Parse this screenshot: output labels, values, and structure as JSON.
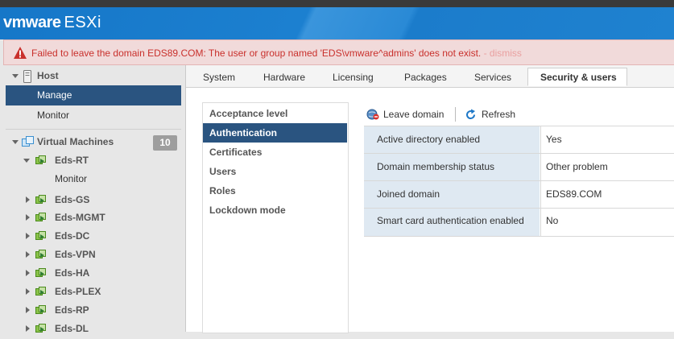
{
  "app": {
    "logo_vm": "vmware",
    "logo_product": "ESXi"
  },
  "alert": {
    "message": "Failed to leave the domain EDS89.COM: The user or group named 'EDS\\vmware^admins' does not exist.",
    "dismiss": " - dismiss"
  },
  "sidebar": {
    "host": {
      "label": "Host",
      "items": [
        "Manage",
        "Monitor"
      ]
    },
    "vms": {
      "label": "Virtual Machines",
      "count": "10",
      "list": [
        {
          "name": "Eds-RT",
          "expanded": true,
          "children": [
            "Monitor"
          ]
        },
        {
          "name": "Eds-GS"
        },
        {
          "name": "Eds-MGMT"
        },
        {
          "name": "Eds-DC"
        },
        {
          "name": "Eds-VPN"
        },
        {
          "name": "Eds-HA"
        },
        {
          "name": "Eds-PLEX"
        },
        {
          "name": "Eds-RP"
        },
        {
          "name": "Eds-DL"
        }
      ]
    }
  },
  "tabs": [
    "System",
    "Hardware",
    "Licensing",
    "Packages",
    "Services",
    "Security & users"
  ],
  "active_tab": "Security & users",
  "subnav": [
    "Acceptance level",
    "Authentication",
    "Certificates",
    "Users",
    "Roles",
    "Lockdown mode"
  ],
  "active_subnav": "Authentication",
  "toolbar": {
    "leave_domain": "Leave domain",
    "refresh": "Refresh"
  },
  "auth_table": [
    {
      "key": "Active directory enabled",
      "value": "Yes"
    },
    {
      "key": "Domain membership status",
      "value": "Other problem"
    },
    {
      "key": "Joined domain",
      "value": "EDS89.COM"
    },
    {
      "key": "Smart card authentication enabled",
      "value": "No"
    }
  ],
  "colors": {
    "header": "#1e78c8",
    "selected": "#2a5480",
    "alert_text": "#c9302c",
    "key_cell": "#dfe9f2"
  }
}
